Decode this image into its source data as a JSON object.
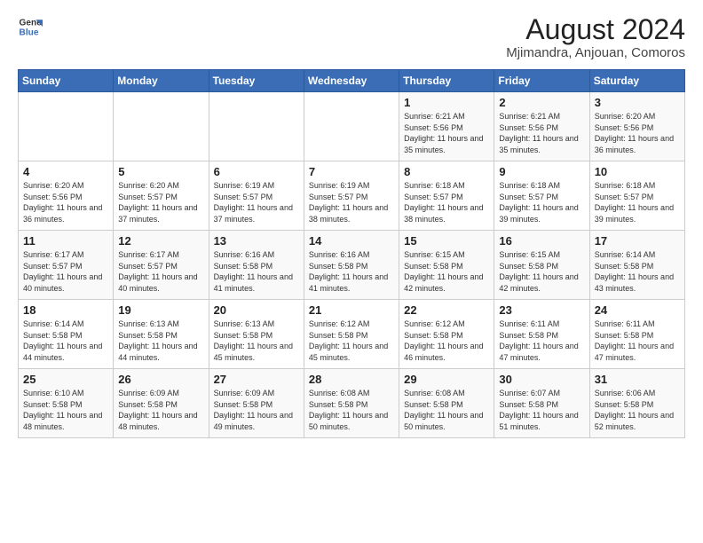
{
  "logo": {
    "line1": "General",
    "line2": "Blue"
  },
  "title": "August 2024",
  "location": "Mjimandra, Anjouan, Comoros",
  "weekdays": [
    "Sunday",
    "Monday",
    "Tuesday",
    "Wednesday",
    "Thursday",
    "Friday",
    "Saturday"
  ],
  "weeks": [
    [
      {
        "day": "",
        "sunrise": "",
        "sunset": "",
        "daylight": ""
      },
      {
        "day": "",
        "sunrise": "",
        "sunset": "",
        "daylight": ""
      },
      {
        "day": "",
        "sunrise": "",
        "sunset": "",
        "daylight": ""
      },
      {
        "day": "",
        "sunrise": "",
        "sunset": "",
        "daylight": ""
      },
      {
        "day": "1",
        "sunrise": "Sunrise: 6:21 AM",
        "sunset": "Sunset: 5:56 PM",
        "daylight": "Daylight: 11 hours and 35 minutes."
      },
      {
        "day": "2",
        "sunrise": "Sunrise: 6:21 AM",
        "sunset": "Sunset: 5:56 PM",
        "daylight": "Daylight: 11 hours and 35 minutes."
      },
      {
        "day": "3",
        "sunrise": "Sunrise: 6:20 AM",
        "sunset": "Sunset: 5:56 PM",
        "daylight": "Daylight: 11 hours and 36 minutes."
      }
    ],
    [
      {
        "day": "4",
        "sunrise": "Sunrise: 6:20 AM",
        "sunset": "Sunset: 5:56 PM",
        "daylight": "Daylight: 11 hours and 36 minutes."
      },
      {
        "day": "5",
        "sunrise": "Sunrise: 6:20 AM",
        "sunset": "Sunset: 5:57 PM",
        "daylight": "Daylight: 11 hours and 37 minutes."
      },
      {
        "day": "6",
        "sunrise": "Sunrise: 6:19 AM",
        "sunset": "Sunset: 5:57 PM",
        "daylight": "Daylight: 11 hours and 37 minutes."
      },
      {
        "day": "7",
        "sunrise": "Sunrise: 6:19 AM",
        "sunset": "Sunset: 5:57 PM",
        "daylight": "Daylight: 11 hours and 38 minutes."
      },
      {
        "day": "8",
        "sunrise": "Sunrise: 6:18 AM",
        "sunset": "Sunset: 5:57 PM",
        "daylight": "Daylight: 11 hours and 38 minutes."
      },
      {
        "day": "9",
        "sunrise": "Sunrise: 6:18 AM",
        "sunset": "Sunset: 5:57 PM",
        "daylight": "Daylight: 11 hours and 39 minutes."
      },
      {
        "day": "10",
        "sunrise": "Sunrise: 6:18 AM",
        "sunset": "Sunset: 5:57 PM",
        "daylight": "Daylight: 11 hours and 39 minutes."
      }
    ],
    [
      {
        "day": "11",
        "sunrise": "Sunrise: 6:17 AM",
        "sunset": "Sunset: 5:57 PM",
        "daylight": "Daylight: 11 hours and 40 minutes."
      },
      {
        "day": "12",
        "sunrise": "Sunrise: 6:17 AM",
        "sunset": "Sunset: 5:57 PM",
        "daylight": "Daylight: 11 hours and 40 minutes."
      },
      {
        "day": "13",
        "sunrise": "Sunrise: 6:16 AM",
        "sunset": "Sunset: 5:58 PM",
        "daylight": "Daylight: 11 hours and 41 minutes."
      },
      {
        "day": "14",
        "sunrise": "Sunrise: 6:16 AM",
        "sunset": "Sunset: 5:58 PM",
        "daylight": "Daylight: 11 hours and 41 minutes."
      },
      {
        "day": "15",
        "sunrise": "Sunrise: 6:15 AM",
        "sunset": "Sunset: 5:58 PM",
        "daylight": "Daylight: 11 hours and 42 minutes."
      },
      {
        "day": "16",
        "sunrise": "Sunrise: 6:15 AM",
        "sunset": "Sunset: 5:58 PM",
        "daylight": "Daylight: 11 hours and 42 minutes."
      },
      {
        "day": "17",
        "sunrise": "Sunrise: 6:14 AM",
        "sunset": "Sunset: 5:58 PM",
        "daylight": "Daylight: 11 hours and 43 minutes."
      }
    ],
    [
      {
        "day": "18",
        "sunrise": "Sunrise: 6:14 AM",
        "sunset": "Sunset: 5:58 PM",
        "daylight": "Daylight: 11 hours and 44 minutes."
      },
      {
        "day": "19",
        "sunrise": "Sunrise: 6:13 AM",
        "sunset": "Sunset: 5:58 PM",
        "daylight": "Daylight: 11 hours and 44 minutes."
      },
      {
        "day": "20",
        "sunrise": "Sunrise: 6:13 AM",
        "sunset": "Sunset: 5:58 PM",
        "daylight": "Daylight: 11 hours and 45 minutes."
      },
      {
        "day": "21",
        "sunrise": "Sunrise: 6:12 AM",
        "sunset": "Sunset: 5:58 PM",
        "daylight": "Daylight: 11 hours and 45 minutes."
      },
      {
        "day": "22",
        "sunrise": "Sunrise: 6:12 AM",
        "sunset": "Sunset: 5:58 PM",
        "daylight": "Daylight: 11 hours and 46 minutes."
      },
      {
        "day": "23",
        "sunrise": "Sunrise: 6:11 AM",
        "sunset": "Sunset: 5:58 PM",
        "daylight": "Daylight: 11 hours and 47 minutes."
      },
      {
        "day": "24",
        "sunrise": "Sunrise: 6:11 AM",
        "sunset": "Sunset: 5:58 PM",
        "daylight": "Daylight: 11 hours and 47 minutes."
      }
    ],
    [
      {
        "day": "25",
        "sunrise": "Sunrise: 6:10 AM",
        "sunset": "Sunset: 5:58 PM",
        "daylight": "Daylight: 11 hours and 48 minutes."
      },
      {
        "day": "26",
        "sunrise": "Sunrise: 6:09 AM",
        "sunset": "Sunset: 5:58 PM",
        "daylight": "Daylight: 11 hours and 48 minutes."
      },
      {
        "day": "27",
        "sunrise": "Sunrise: 6:09 AM",
        "sunset": "Sunset: 5:58 PM",
        "daylight": "Daylight: 11 hours and 49 minutes."
      },
      {
        "day": "28",
        "sunrise": "Sunrise: 6:08 AM",
        "sunset": "Sunset: 5:58 PM",
        "daylight": "Daylight: 11 hours and 50 minutes."
      },
      {
        "day": "29",
        "sunrise": "Sunrise: 6:08 AM",
        "sunset": "Sunset: 5:58 PM",
        "daylight": "Daylight: 11 hours and 50 minutes."
      },
      {
        "day": "30",
        "sunrise": "Sunrise: 6:07 AM",
        "sunset": "Sunset: 5:58 PM",
        "daylight": "Daylight: 11 hours and 51 minutes."
      },
      {
        "day": "31",
        "sunrise": "Sunrise: 6:06 AM",
        "sunset": "Sunset: 5:58 PM",
        "daylight": "Daylight: 11 hours and 52 minutes."
      }
    ]
  ]
}
